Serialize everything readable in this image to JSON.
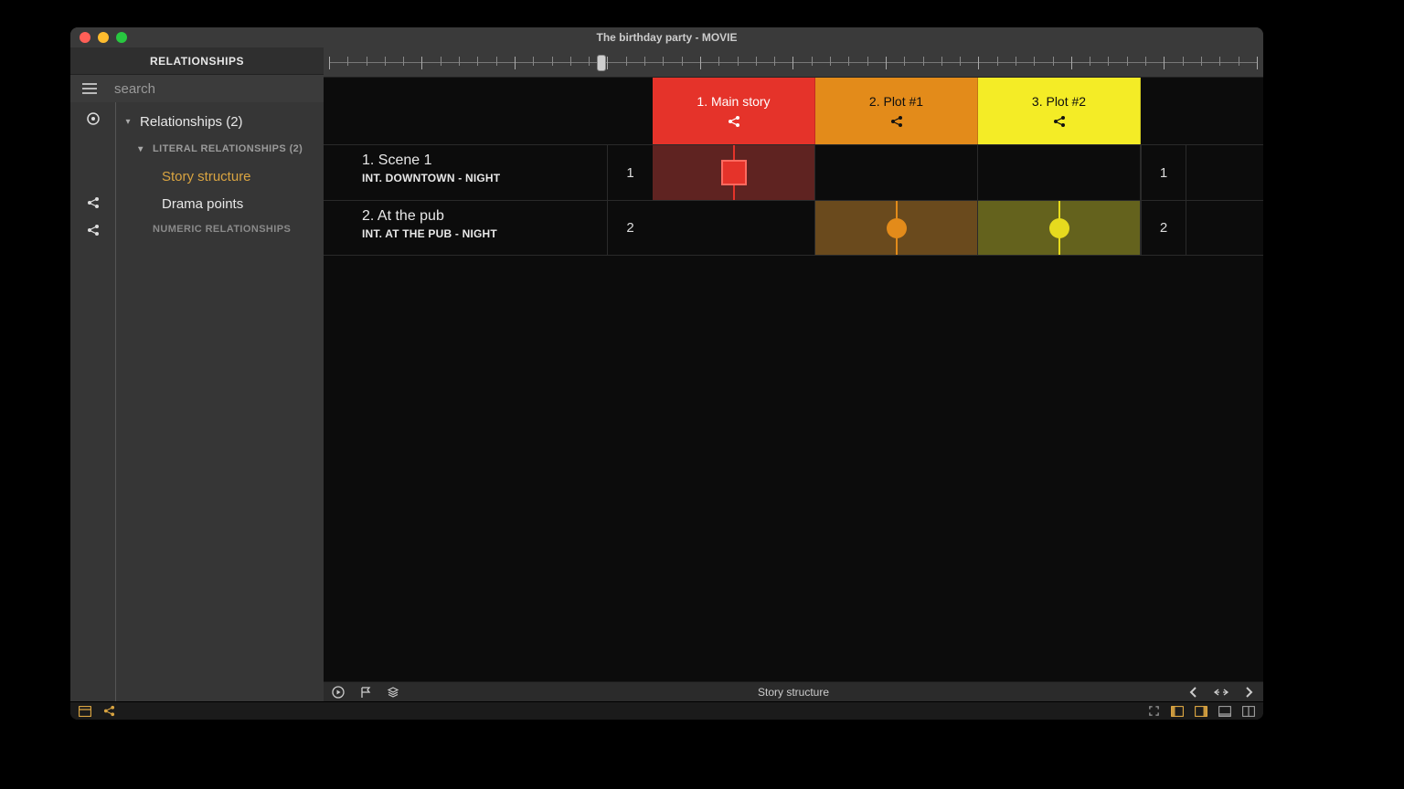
{
  "window": {
    "title": "The birthday party - MOVIE"
  },
  "sidebar": {
    "title": "RELATIONSHIPS",
    "search_placeholder": "search",
    "root_label": "Relationships (2)",
    "literal_label": "LITERAL RELATIONSHIPS (2)",
    "numeric_label": "NUMERIC RELATIONSHIPS",
    "items": [
      {
        "label": "Story structure",
        "active": true
      },
      {
        "label": "Drama points",
        "active": false
      }
    ]
  },
  "ruler": {
    "handle_percent": 29.6
  },
  "plots": [
    {
      "label": "1. Main story",
      "color": "#e5332a",
      "class": "red"
    },
    {
      "label": "2. Plot #1",
      "color": "#e38b1a",
      "class": "orange"
    },
    {
      "label": "3. Plot #2",
      "color": "#f4ec26",
      "class": "yellow"
    }
  ],
  "scenes": [
    {
      "num": "1",
      "title": "1. Scene 1",
      "sub": "INT.  DOWNTOWN - NIGHT",
      "cells": [
        "square-red",
        "",
        ""
      ]
    },
    {
      "num": "2",
      "title": "2. At the pub",
      "sub": "INT.  AT THE PUB - NIGHT",
      "cells": [
        "",
        "circle-orange",
        "circle-yellow"
      ]
    }
  ],
  "footer": {
    "label": "Story structure"
  },
  "colwidths": {
    "plot": 178
  }
}
